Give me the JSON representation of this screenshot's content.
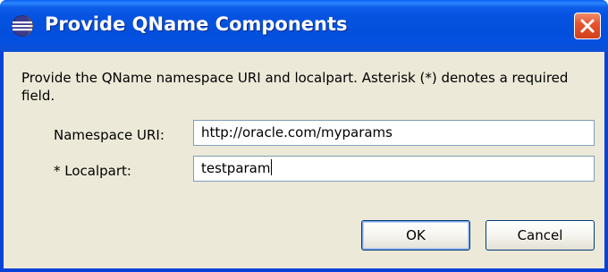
{
  "window": {
    "title": "Provide QName Components",
    "icon": "eclipse-icon",
    "close_icon": "close-icon",
    "colors": {
      "titlebar": "#0553e0",
      "client": "#ece9d8",
      "close": "#e5552f"
    }
  },
  "message": "Provide the QName namespace URI and localpart.  Asterisk (*) denotes a required field.",
  "fields": {
    "namespace": {
      "label": "Namespace URI:",
      "value": "http://oracle.com/myparams"
    },
    "localpart": {
      "label": "* Localpart:",
      "value": "testparam"
    }
  },
  "buttons": {
    "ok": "OK",
    "cancel": "Cancel"
  }
}
